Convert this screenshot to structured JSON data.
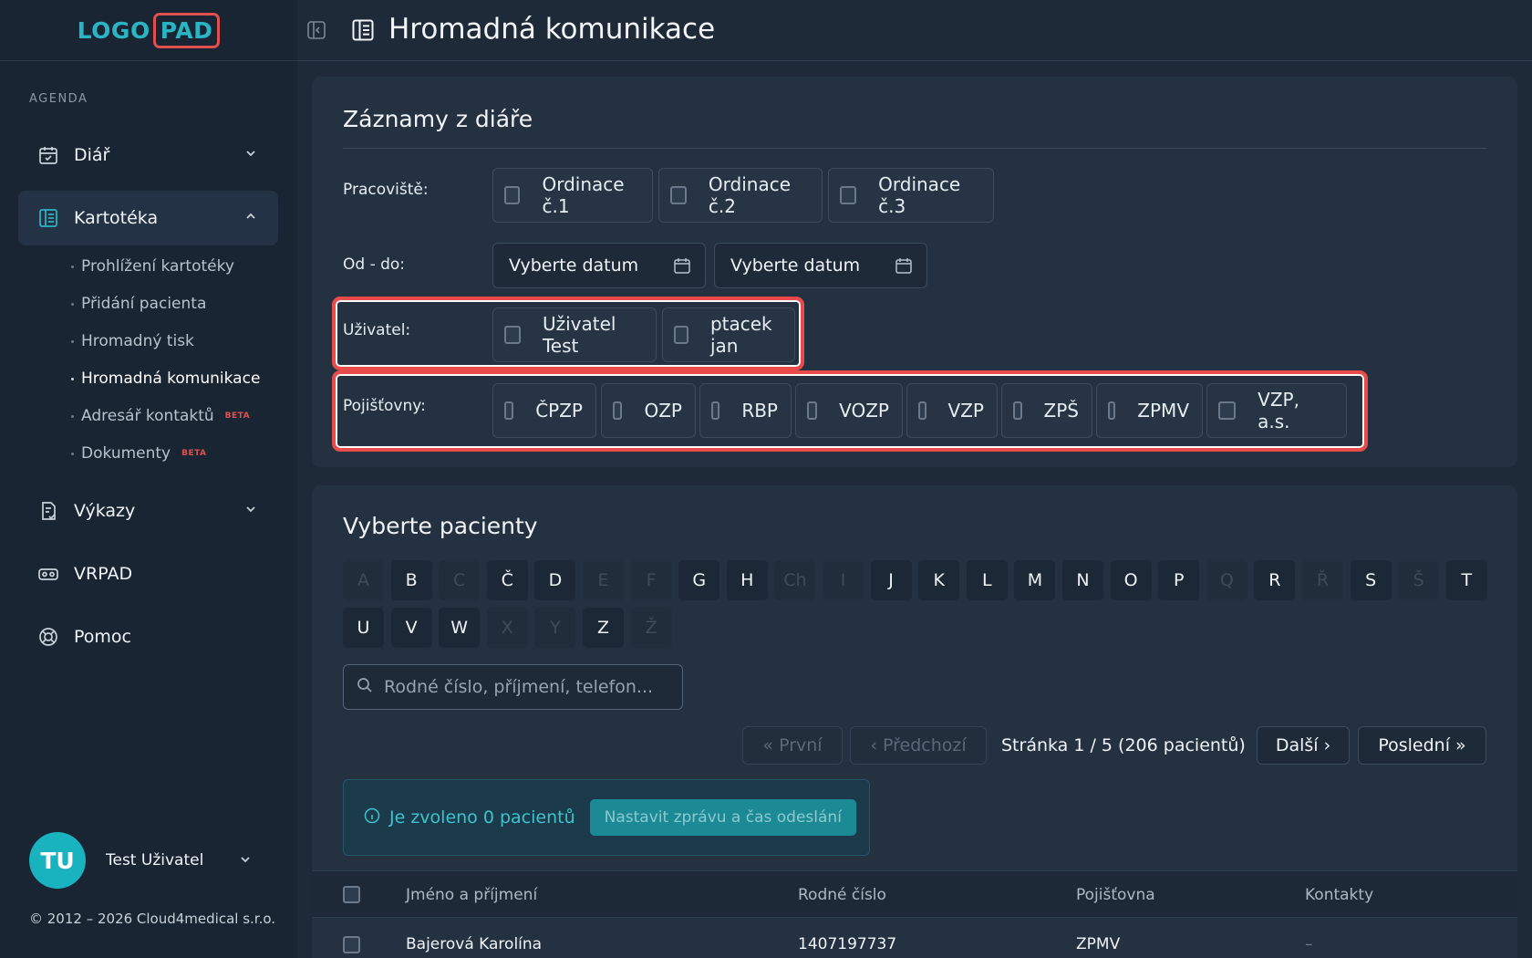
{
  "logo": {
    "left": "LOGO",
    "right": "PAD"
  },
  "sidebar": {
    "section_label": "AGENDA",
    "items": [
      {
        "label": "Diář"
      },
      {
        "label": "Kartotéka"
      },
      {
        "label": "Výkazy"
      },
      {
        "label": "VRPAD"
      },
      {
        "label": "Pomoc"
      }
    ],
    "subitems": [
      {
        "label": "Prohlížení kartotéky"
      },
      {
        "label": "Přidání pacienta"
      },
      {
        "label": "Hromadný tisk"
      },
      {
        "label": "Hromadná komunikace"
      },
      {
        "label": "Adresář kontaktů",
        "badge": "BETA"
      },
      {
        "label": "Dokumenty",
        "badge": "BETA"
      }
    ]
  },
  "user": {
    "initials": "TU",
    "name": "Test Uživatel"
  },
  "copyright": "© 2012 – 2026 Cloud4medical s.r.o.",
  "header": {
    "title": "Hromadná komunikace"
  },
  "records": {
    "title": "Záznamy z diáře",
    "workplace_label": "Pracoviště:",
    "workplaces": [
      "Ordinace č.1",
      "Ordinace č.2",
      "Ordinace č.3"
    ],
    "date_label": "Od - do:",
    "date_from": "Vyberte datum",
    "date_to": "Vyberte datum",
    "user_label": "Uživatel:",
    "users": [
      "Uživatel Test",
      "ptacek jan"
    ],
    "insurers_label": "Pojišťovny:",
    "insurers": [
      "ČPZP",
      "OZP",
      "RBP",
      "VOZP",
      "VZP",
      "ZPŠ",
      "ZPMV",
      "VZP, a.s."
    ]
  },
  "patients": {
    "title": "Vyberte pacienty",
    "letters_row1": [
      "A",
      "B",
      "C",
      "Č",
      "D",
      "E",
      "F",
      "G",
      "H",
      "Ch",
      "I",
      "J",
      "K",
      "L",
      "M",
      "N",
      "O",
      "P",
      "Q",
      "R",
      "Ř",
      "S",
      "Š",
      "T"
    ],
    "letters_row2": [
      "U",
      "V",
      "W",
      "X",
      "Y",
      "Z",
      "Ž"
    ],
    "disabled_letters": [
      "A",
      "C",
      "E",
      "F",
      "Ch",
      "I",
      "Q",
      "Ř",
      "Š",
      "X",
      "Y",
      "Ž"
    ],
    "search_placeholder": "Rodné číslo, příjmení, telefon...",
    "pagination": {
      "first": "« První",
      "prev": "‹ Předchozí",
      "info": "Stránka 1 / 5 (206 pacientů)",
      "next": "Další ›",
      "last": "Poslední »"
    },
    "selected_text": "Je zvoleno 0 pacientů",
    "set_message_button": "Nastavit zprávu a čas odeslání",
    "table": {
      "headers": [
        "Jméno a příjmení",
        "Rodné číslo",
        "Pojišťovna",
        "Kontakty"
      ],
      "rows": [
        {
          "name": "Bajerová Karolína",
          "birth_number": "1407197737",
          "insurer": "ZPMV",
          "contacts": "–"
        }
      ]
    }
  },
  "colors": {
    "accent": "#2bb5c4",
    "highlight": "#e94b4b",
    "background": "#1e2a38"
  }
}
